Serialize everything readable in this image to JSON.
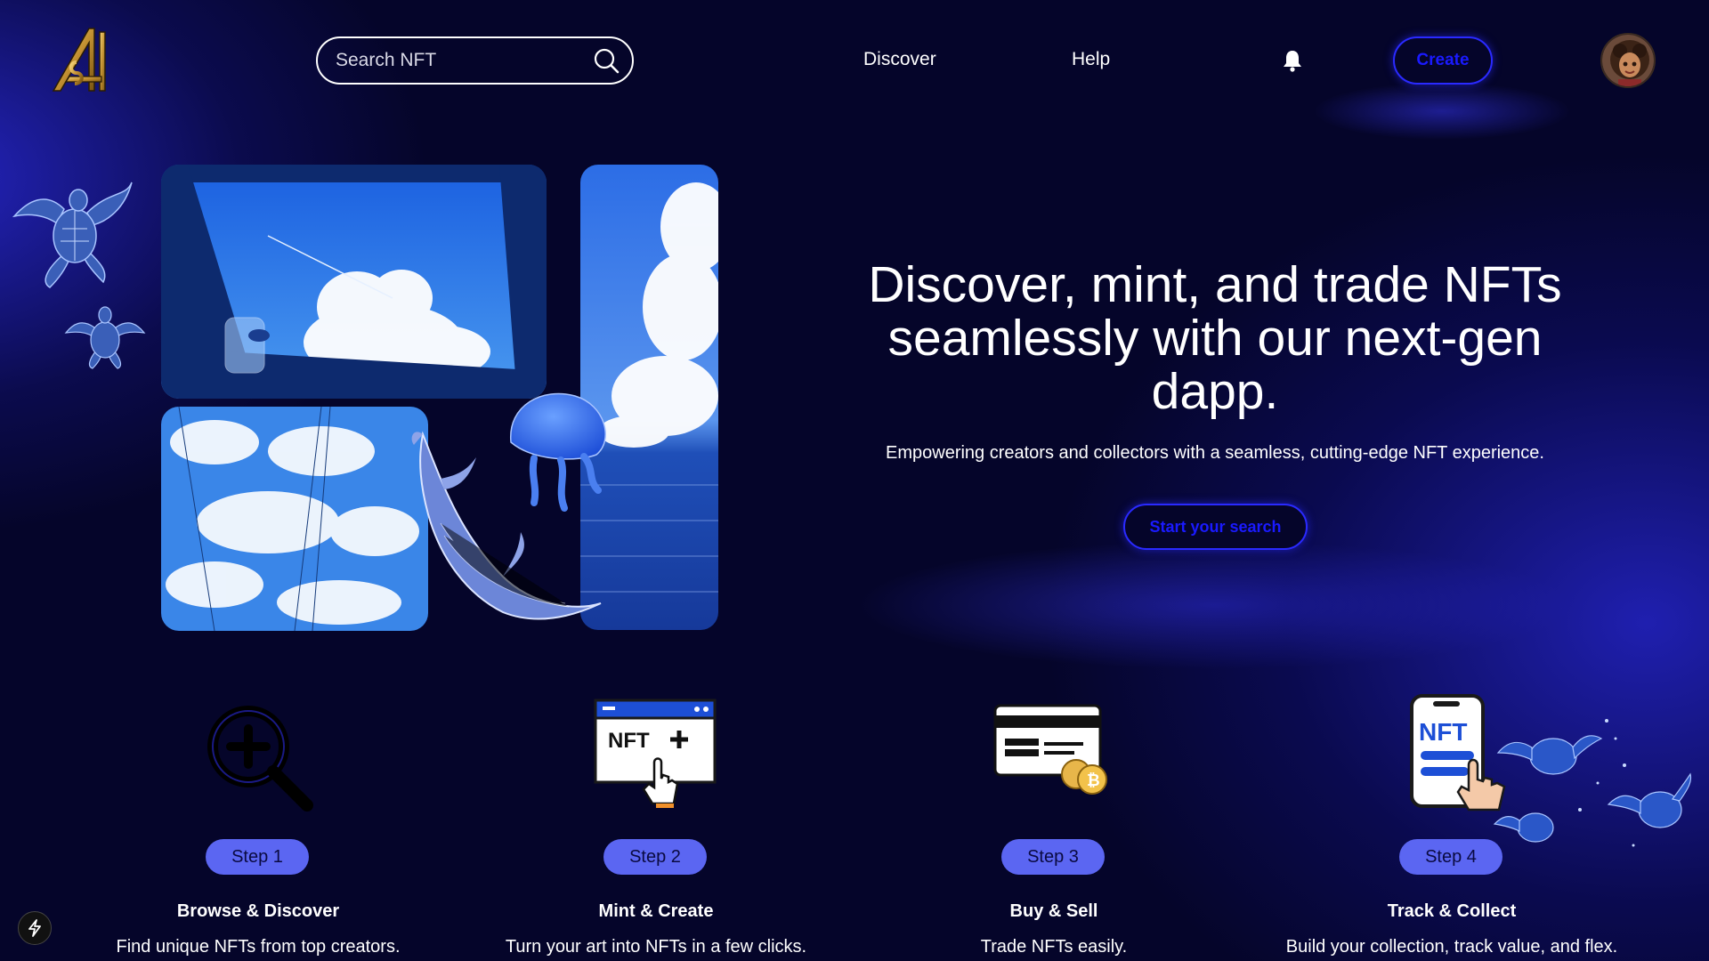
{
  "header": {
    "logo_text": "ASH",
    "search_placeholder": "Search NFT",
    "nav": [
      "Discover",
      "Help"
    ],
    "create_label": "Create"
  },
  "hero": {
    "title": "Discover, mint, and trade NFTs seamlessly with our next-gen dapp.",
    "subtitle": "Empowering creators and collectors with a seamless, cutting-edge NFT experience.",
    "cta": "Start your search"
  },
  "steps": [
    {
      "pill": "Step 1",
      "title": "Browse & Discover",
      "desc": "Find unique NFTs from top creators.",
      "icon": "magnifier-plus-icon"
    },
    {
      "pill": "Step 2",
      "title": "Mint & Create",
      "desc": "Turn your art into NFTs in a few clicks.",
      "icon": "nft-mint-window-icon"
    },
    {
      "pill": "Step 3",
      "title": "Buy & Sell",
      "desc": "Trade NFTs easily.",
      "icon": "card-coins-icon"
    },
    {
      "pill": "Step 4",
      "title": "Track & Collect",
      "desc": "Build your collection, track value, and flex.",
      "icon": "nft-phone-icon"
    }
  ],
  "illustration_labels": {
    "mint_window": "NFT",
    "phone": "NFT"
  },
  "colors": {
    "background": "#05052a",
    "accent": "#2a2aff",
    "pill": "#5b66f2"
  }
}
